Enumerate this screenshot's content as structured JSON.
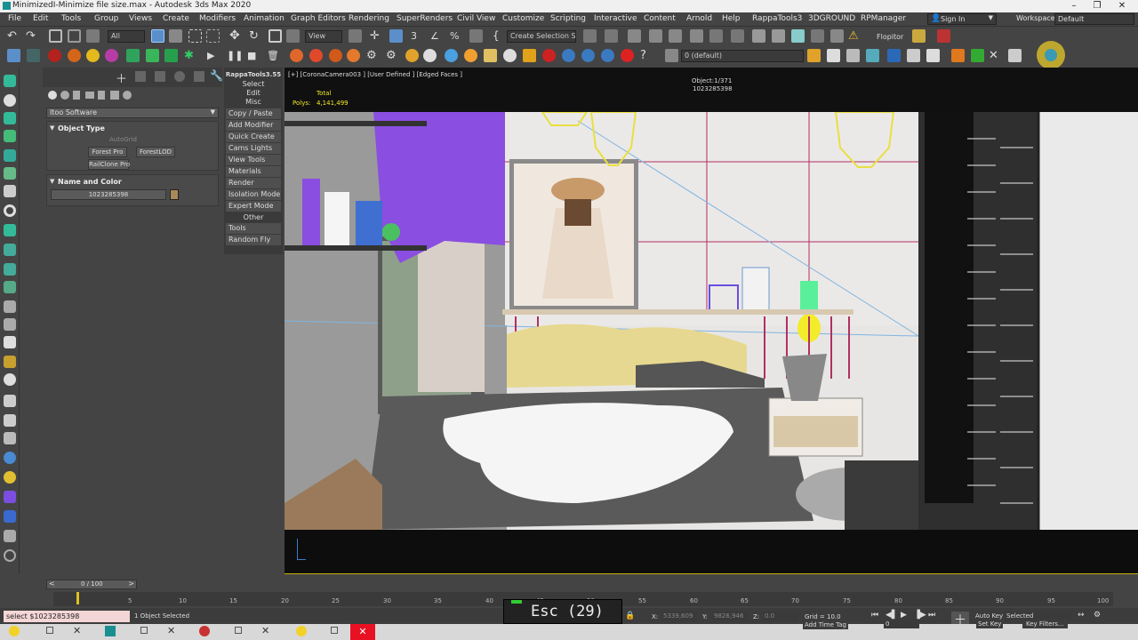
{
  "window": {
    "title": "MinimizedI-Minimize file size.max - Autodesk 3ds Max 2020"
  },
  "menu": [
    "File",
    "Edit",
    "Tools",
    "Group",
    "Views",
    "Create",
    "Modifiers",
    "Animation",
    "Graph Editors",
    "Rendering",
    "SuperRenders",
    "Civil View",
    "Customize",
    "Scripting",
    "Interactive",
    "Content",
    "Arnold",
    "Help",
    "RappaTools3",
    "3DGROUND",
    "RPManager"
  ],
  "account": {
    "sign_in": "Sign In",
    "workspaces_label": "Workspaces:",
    "workspaces_value": "Default"
  },
  "toolbar": {
    "filter": "All",
    "ref_coord": "View",
    "selection_set": "Create Selection Se",
    "flopitor": "Flopitor",
    "layer": "0 (default)"
  },
  "command_panel": {
    "category": "Itoo Software",
    "object_type_title": "Object Type",
    "autogrid": "AutoGrid",
    "buttons": [
      "Forest Pro",
      "ForestLOD",
      "RailClone Pro"
    ],
    "name_color_title": "Name and Color",
    "object_name": "1023285398"
  },
  "rappatools": {
    "title": "RappaTools3.55",
    "items": [
      "Select",
      "Edit",
      "Misc",
      "Copy / Paste",
      "Add Modifier",
      "Quick Create",
      "Cams Lights",
      "View Tools",
      "Materials",
      "Render",
      "Isolation Mode",
      "Expert Mode",
      "Other",
      "Tools",
      "Random Fly"
    ]
  },
  "viewport": {
    "label": "[+] [CoronaCamera003 ] [User Defined ] [Edged Faces ]",
    "stats_total": "Total",
    "stats_polys_label": "Polys:",
    "stats_polys_value": "4,141,499",
    "object_count": "Object:1/371",
    "object_id": "1023285398"
  },
  "timeline": {
    "frame": "0 / 100",
    "ticks": [
      "0",
      "5",
      "10",
      "15",
      "20",
      "25",
      "30",
      "35",
      "40",
      "45",
      "50",
      "55",
      "60",
      "65",
      "70",
      "75",
      "80",
      "85",
      "90",
      "95",
      "100"
    ]
  },
  "status": {
    "maxscript": "select $1023285398",
    "selected": "1 Object Selected",
    "keyhint": "Esc (29)",
    "x_label": "X:",
    "x_value": "5339,609",
    "y_label": "Y:",
    "y_value": "9826,946",
    "z_label": "Z:",
    "z_value": "0.0",
    "grid": "Grid = 10.0",
    "add_time_tag": "Add Time Tag",
    "auto_key": "Auto Key",
    "set_key": "Set Key",
    "selected_dropdown": "Selected",
    "key_filters": "Key Filters...",
    "frame_field": "0"
  },
  "colors": {
    "accent": "#4a90d9",
    "viewport_border": "#c8b400",
    "purple": "#8a4ee0",
    "yellow": "#f2ec2a"
  }
}
